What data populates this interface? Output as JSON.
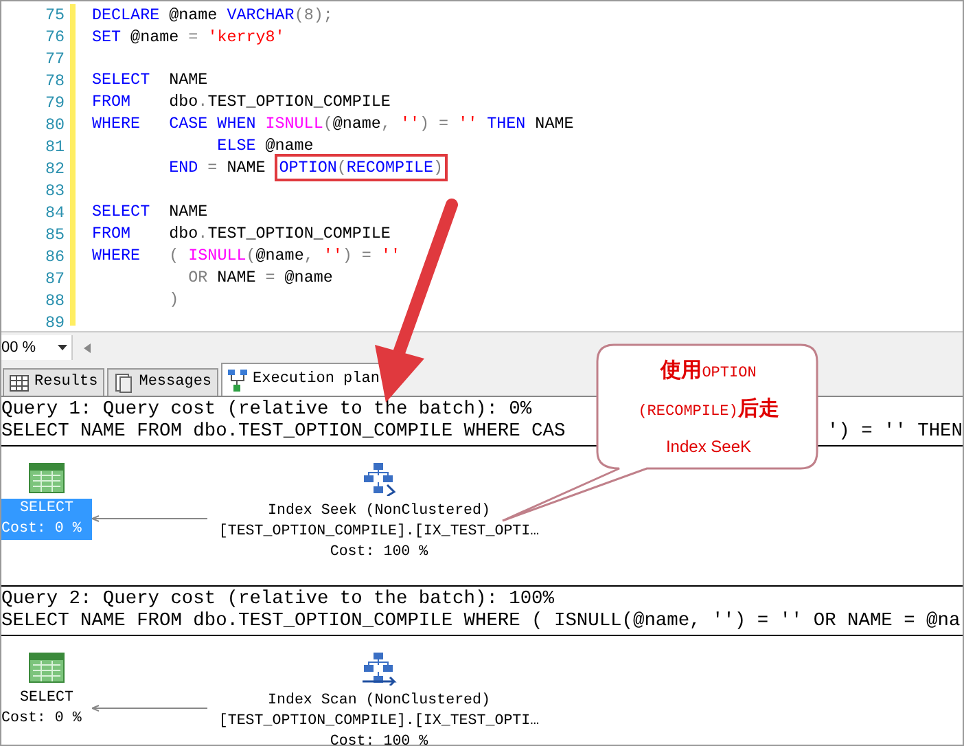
{
  "editor": {
    "lines": [
      {
        "number": "75",
        "tokens": [
          {
            "kind": "keyword",
            "text": "DECLARE"
          },
          {
            "kind": "plain",
            "text": " @name "
          },
          {
            "kind": "keyword",
            "text": "VARCHAR"
          },
          {
            "kind": "operator",
            "text": "(8);"
          }
        ]
      },
      {
        "number": "76",
        "tokens": [
          {
            "kind": "keyword",
            "text": "SET"
          },
          {
            "kind": "plain",
            "text": " @name "
          },
          {
            "kind": "operator",
            "text": "= "
          },
          {
            "kind": "string",
            "text": "'kerry8'"
          }
        ]
      },
      {
        "number": "77"
      },
      {
        "number": "78",
        "tokens": [
          {
            "kind": "keyword",
            "text": "SELECT"
          },
          {
            "kind": "plain",
            "text": "  NAME"
          }
        ]
      },
      {
        "number": "79",
        "tokens": [
          {
            "kind": "keyword",
            "text": "FROM"
          },
          {
            "kind": "plain",
            "text": "    dbo"
          },
          {
            "kind": "operator",
            "text": "."
          },
          {
            "kind": "plain",
            "text": "TEST_OPTION_COMPILE"
          }
        ]
      },
      {
        "number": "80",
        "tokens": [
          {
            "kind": "keyword",
            "text": "WHERE   CASE WHEN "
          },
          {
            "kind": "function",
            "text": "ISNULL"
          },
          {
            "kind": "operator",
            "text": "("
          },
          {
            "kind": "plain",
            "text": "@name"
          },
          {
            "kind": "operator",
            "text": ", "
          },
          {
            "kind": "string",
            "text": "''"
          },
          {
            "kind": "operator",
            "text": ") = "
          },
          {
            "kind": "string",
            "text": "'' "
          },
          {
            "kind": "keyword",
            "text": "THEN"
          },
          {
            "kind": "plain",
            "text": " NAME"
          }
        ]
      },
      {
        "number": "81",
        "tokens": [
          {
            "kind": "keyword",
            "text": "             ELSE"
          },
          {
            "kind": "plain",
            "text": " @name"
          }
        ]
      },
      {
        "number": "82",
        "tokens": [
          {
            "kind": "keyword",
            "text": "        END "
          },
          {
            "kind": "operator",
            "text": "="
          },
          {
            "kind": "plain",
            "text": " NAME "
          }
        ],
        "boxed": [
          {
            "kind": "keyword",
            "text": "OPTION"
          },
          {
            "kind": "operator",
            "text": "("
          },
          {
            "kind": "keyword",
            "text": "RECOMPILE"
          },
          {
            "kind": "operator",
            "text": ")"
          }
        ]
      },
      {
        "number": "83"
      },
      {
        "number": "84",
        "tokens": [
          {
            "kind": "keyword",
            "text": "SELECT"
          },
          {
            "kind": "plain",
            "text": "  NAME"
          }
        ]
      },
      {
        "number": "85",
        "tokens": [
          {
            "kind": "keyword",
            "text": "FROM"
          },
          {
            "kind": "plain",
            "text": "    dbo"
          },
          {
            "kind": "operator",
            "text": "."
          },
          {
            "kind": "plain",
            "text": "TEST_OPTION_COMPILE"
          }
        ]
      },
      {
        "number": "86",
        "tokens": [
          {
            "kind": "keyword",
            "text": "WHERE"
          },
          {
            "kind": "operator",
            "text": "   ( "
          },
          {
            "kind": "function",
            "text": "ISNULL"
          },
          {
            "kind": "operator",
            "text": "("
          },
          {
            "kind": "plain",
            "text": "@name"
          },
          {
            "kind": "operator",
            "text": ", "
          },
          {
            "kind": "string",
            "text": "''"
          },
          {
            "kind": "operator",
            "text": ") = "
          },
          {
            "kind": "string",
            "text": "''"
          }
        ]
      },
      {
        "number": "87",
        "tokens": [
          {
            "kind": "operator",
            "text": "          OR"
          },
          {
            "kind": "plain",
            "text": " NAME "
          },
          {
            "kind": "operator",
            "text": "="
          },
          {
            "kind": "plain",
            "text": " @name"
          }
        ]
      },
      {
        "number": "88",
        "tokens": [
          {
            "kind": "operator",
            "text": "        )"
          }
        ]
      },
      {
        "number": "89"
      }
    ]
  },
  "zoom": {
    "value": "00 %"
  },
  "tabs": [
    {
      "label": "Results",
      "kind": "grid",
      "selected": false
    },
    {
      "label": "Messages",
      "kind": "messages",
      "selected": false
    },
    {
      "label": "Execution plan",
      "kind": "plan",
      "selected": true
    }
  ],
  "queries": [
    {
      "header": "Query 1: Query cost (relative to the batch): 0%",
      "sql": [
        "SELECT NAME FROM dbo.TEST_OPTION_COMPILE WHERE CAS",
        "') = '' THEN"
      ],
      "nodes": [
        {
          "kind": "select",
          "title": "SELECT",
          "cost": "Cost: 0 %",
          "selected": true
        },
        {
          "kind": "index_seek",
          "title": "Index Seek (NonClustered)",
          "object": "[TEST_OPTION_COMPILE].[IX_TEST_OPTI…",
          "cost": "Cost: 100 %",
          "selected": false
        }
      ]
    },
    {
      "header": "Query 2: Query cost (relative to the batch): 100%",
      "sql": [
        "SELECT NAME FROM dbo.TEST_OPTION_COMPILE WHERE ( ISNULL(@name, '') = '' OR NAME = @na"
      ],
      "nodes": [
        {
          "kind": "select",
          "title": "SELECT",
          "cost": "Cost: 0 %",
          "selected": false
        },
        {
          "kind": "index_scan",
          "title": "Index Scan (NonClustered)",
          "object": "[TEST_OPTION_COMPILE].[IX_TEST_OPTI…",
          "cost": "Cost: 100 %",
          "selected": false
        }
      ]
    }
  ],
  "callout": {
    "lines": [
      "**使用**OPTION",
      "(RECOMPILE)**后走**",
      "Index SeeK"
    ]
  }
}
